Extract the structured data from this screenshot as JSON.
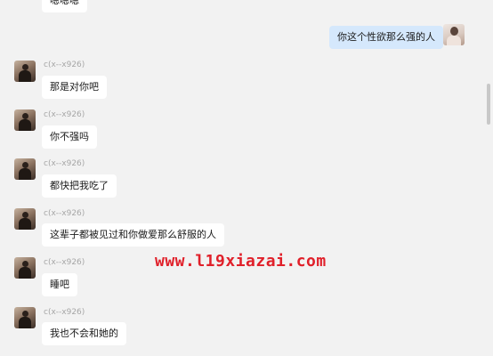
{
  "chat": {
    "top_partial_message": "嗯嗯嗯",
    "self_message": {
      "text": "你这个性欲那么强的人",
      "avatar_icon": "user-avatar-self"
    },
    "messages": [
      {
        "sender": "c(x--x926)",
        "text": "那是对你吧"
      },
      {
        "sender": "c(x--x926)",
        "text": "你不强吗"
      },
      {
        "sender": "c(x--x926)",
        "text": "都快把我吃了"
      },
      {
        "sender": "c(x--x926)",
        "text": "这辈子都被见过和你做爱那么舒服的人"
      },
      {
        "sender": "c(x--x926)",
        "text": "睡吧"
      },
      {
        "sender": "c(x--x926)",
        "text": "我也不会和她的"
      }
    ]
  },
  "watermark": {
    "text": "www.l19xiazai.com",
    "color": "#e0202a"
  },
  "colors": {
    "background": "#f2f2f2",
    "bubble_other": "#ffffff",
    "bubble_self": "#d5e8fc",
    "sender_name": "#a6a6a6"
  }
}
